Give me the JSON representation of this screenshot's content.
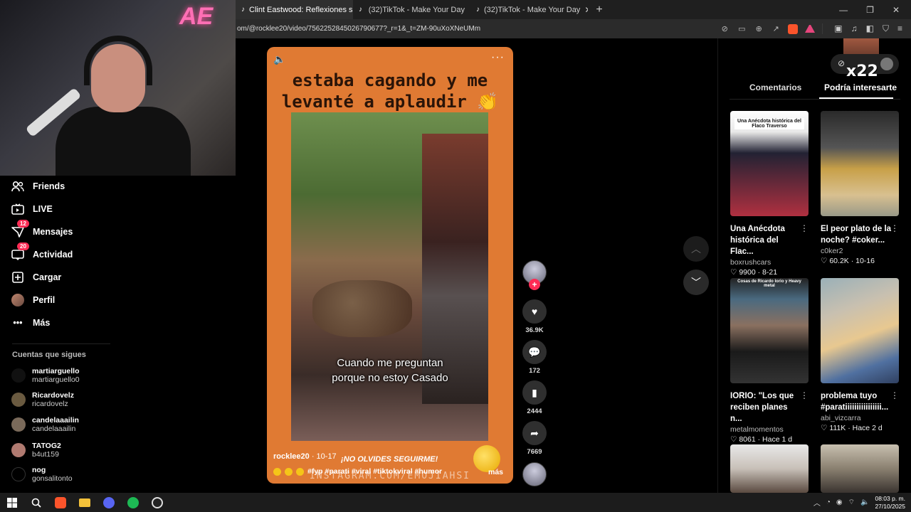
{
  "browser": {
    "tabs": [
      {
        "label": "Clint Eastwood: Reflexiones s",
        "active": true
      },
      {
        "label": "(32)TikTok - Make Your Day",
        "active": false
      },
      {
        "label": "(32)TikTok - Make Your Day",
        "active": false
      }
    ],
    "new_tab": "+",
    "url": "om/@rocklee20/video/7562252845026790677?_r=1&_t=ZM-90uXoXNeUMm"
  },
  "sidebar": {
    "items": [
      {
        "label": "Friends",
        "icon": "friends-icon",
        "badge": ""
      },
      {
        "label": "LIVE",
        "icon": "live-icon",
        "badge": ""
      },
      {
        "label": "Mensajes",
        "icon": "messages-icon",
        "badge": "12"
      },
      {
        "label": "Actividad",
        "icon": "activity-icon",
        "badge": "20"
      },
      {
        "label": "Cargar",
        "icon": "upload-icon",
        "badge": ""
      },
      {
        "label": "Perfil",
        "icon": "profile-icon",
        "badge": ""
      },
      {
        "label": "Más",
        "icon": "more-icon",
        "badge": ""
      }
    ],
    "following_title": "Cuentas que sigues",
    "following": [
      {
        "name": "martiarguello",
        "user": "martiarguello0"
      },
      {
        "name": "Ricardovelz",
        "user": "ricardovelz"
      },
      {
        "name": "candelaaailin",
        "user": "candelaaailin"
      },
      {
        "name": "TATOG2",
        "user": "b4ut159"
      },
      {
        "name": "nog",
        "user": "gonsalitonto"
      }
    ]
  },
  "video": {
    "title_line1": "estaba cagando y me",
    "title_line2": "levanté a aplaudir 👏",
    "caption_line1": "Cuando me preguntan",
    "caption_line2": "porque no estoy Casado",
    "author": "rocklee20",
    "date": " · 10-17",
    "follow_text": "¡NO OLVIDES SEGUIRME!",
    "hashtags": "#fyp #parati #viral #tiktokviral #humor",
    "more": "más",
    "watermark": "INSTAGRAM.COM/EMOJIAHSI"
  },
  "actions": {
    "likes": "36.9K",
    "comments": "172",
    "saves": "2444",
    "shares": "7669"
  },
  "right_panel": {
    "badge_text": "x22",
    "tabs": [
      "Comentarios",
      "Podría interesarte"
    ],
    "cards": [
      {
        "title": "Una Anécdota histórica del Flac...",
        "author": "boxrushcars",
        "stats": "9900 · 8-21",
        "thumb_text": "Una Anécdota histórica del Flaco Traverso"
      },
      {
        "title": "El peor plato de la noche? #coker...",
        "author": "c0ker2",
        "stats": "60.2K · 10-16",
        "thumb_text": ""
      },
      {
        "title": "IORIO: \"Los que reciben planes n...",
        "author": "metalmomentos",
        "stats": "8061 · Hace 1 d",
        "thumb_text": "Cosas de Ricardo Iorio y Heavy metal"
      },
      {
        "title": "problema tuyo #paratiiiiiiiiiiiiiiii...",
        "author": "abi_vizcarra",
        "stats": "111K · Hace 2 d",
        "thumb_text": ""
      }
    ]
  },
  "taskbar": {
    "time": "08:03 p. m.",
    "date": "27/10/2025"
  }
}
